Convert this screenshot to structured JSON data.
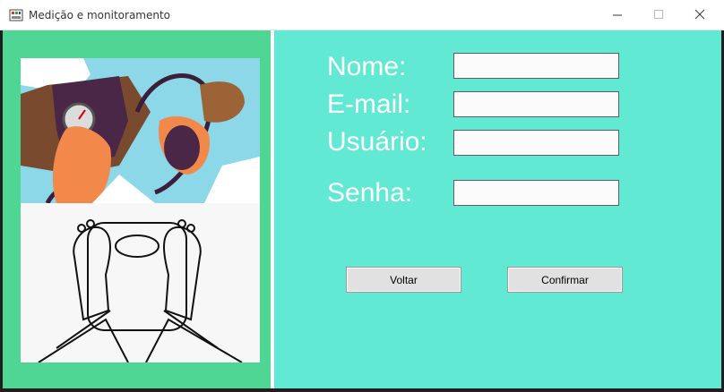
{
  "window": {
    "title": "Medição e monitoramento",
    "icon": "app-icon",
    "controls": {
      "minimize": "minimize-icon",
      "maximize": "maximize-icon",
      "close": "close-icon"
    }
  },
  "colors": {
    "left_panel": "#4fd594",
    "right_panel": "#62e9d4",
    "label_text": "#ffffff"
  },
  "form": {
    "name_label": "Nome:",
    "email_label": "E-mail:",
    "user_label": "Usuário:",
    "password_label": "Senha:",
    "name_value": "",
    "email_value": "",
    "user_value": "",
    "password_value": ""
  },
  "buttons": {
    "back_label": "Voltar",
    "confirm_label": "Confirmar"
  }
}
